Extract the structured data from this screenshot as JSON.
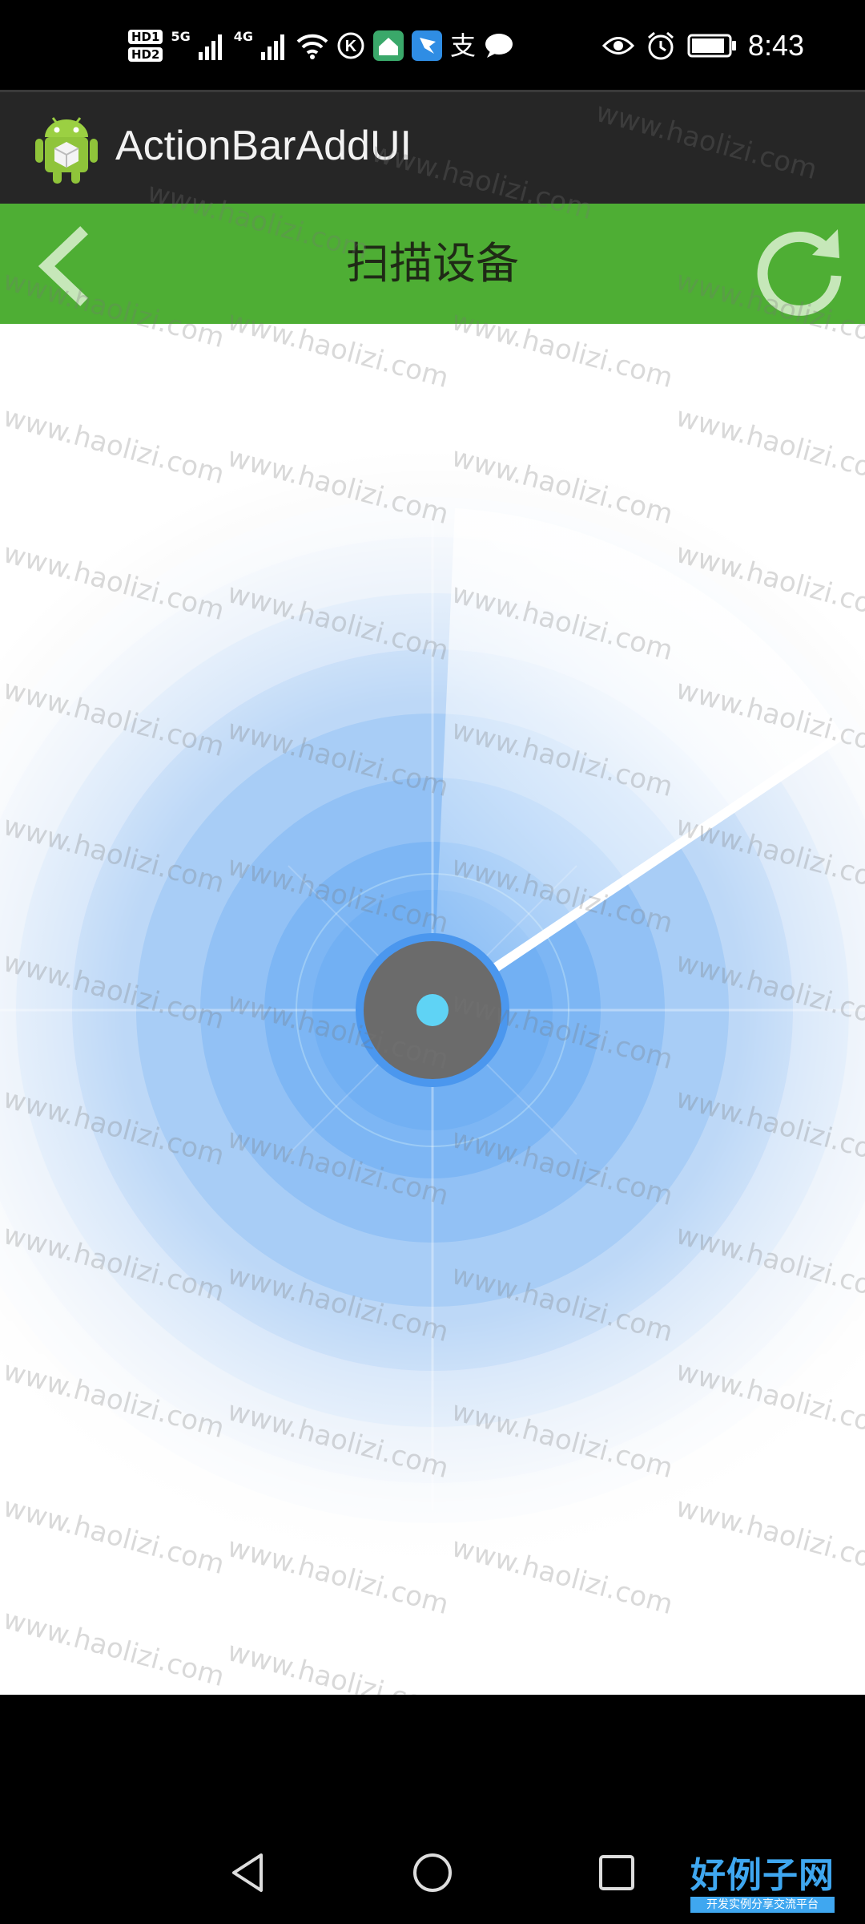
{
  "status_bar": {
    "hd1": "HD1",
    "hd2": "HD2",
    "net_5g": "5G",
    "net_4g": "4G",
    "circle_k": "K",
    "zhi": "支",
    "time": "8:43",
    "icons": [
      "signal-icon",
      "wifi-icon",
      "k-icon",
      "home-app-icon",
      "kite-app-icon",
      "alipay-icon",
      "chat-icon",
      "eye-icon",
      "alarm-icon",
      "battery-icon"
    ]
  },
  "action_bar": {
    "title": "ActionBarAddUI"
  },
  "toolbar": {
    "title": "扫描设备",
    "color": "#4eae34"
  },
  "radar": {
    "accent": "#5aa8f2",
    "center_color": "#6b6b6b",
    "dot_color": "#5fd3f5"
  },
  "watermark": {
    "text": "www.haolizi.com"
  },
  "nav_bar": {
    "buttons": [
      "back-icon",
      "home-icon",
      "recent-apps-icon"
    ]
  },
  "brand": {
    "main": "好例子网",
    "sub": "开发实例分享交流平台"
  }
}
